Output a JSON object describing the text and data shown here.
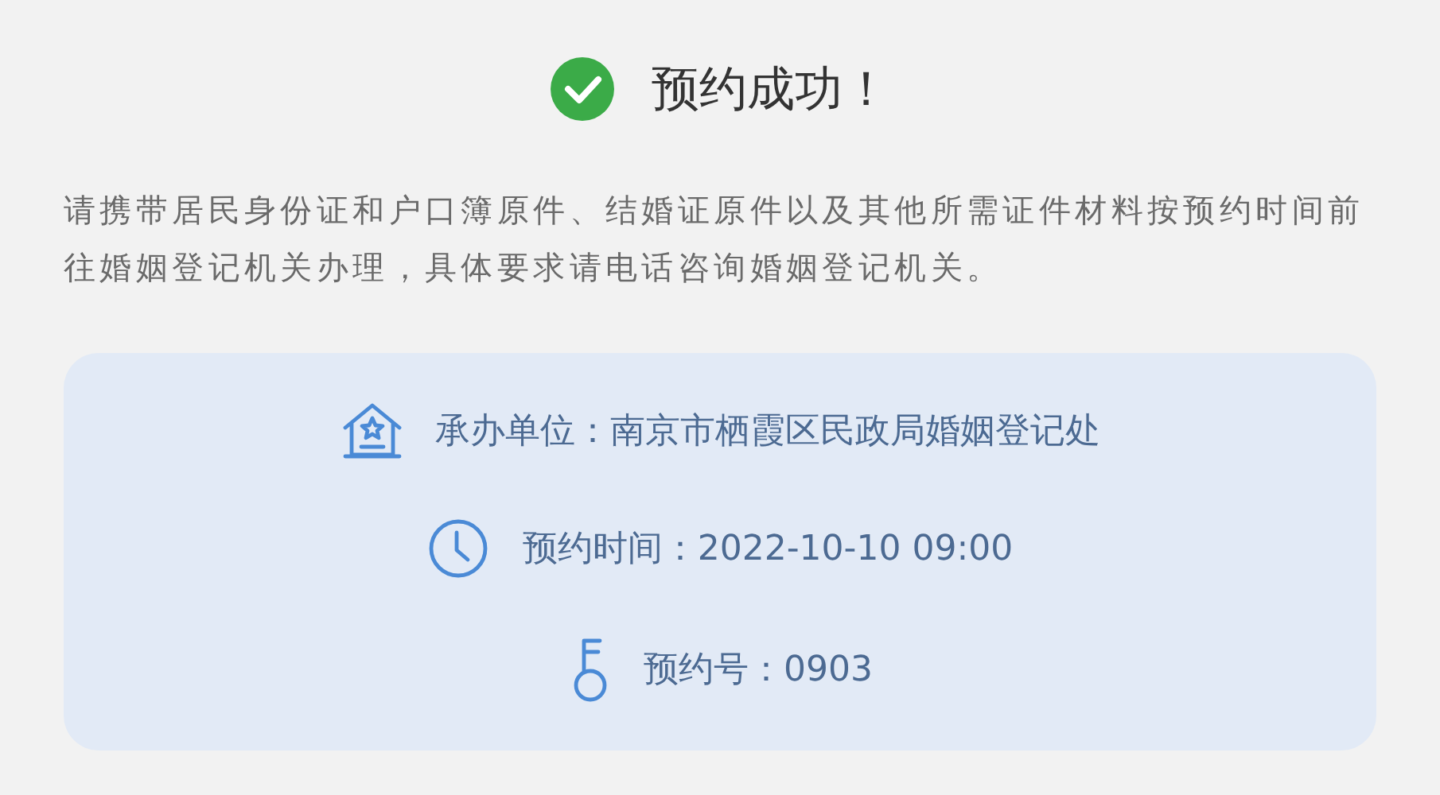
{
  "header": {
    "title": "预约成功！",
    "success": true
  },
  "notice": "请携带居民身份证和户口簿原件、结婚证原件以及其他所需证件材料按预约时间前往婚姻登记机关办理，具体要求请电话咨询婚姻登记机关。",
  "details": [
    {
      "kind": "office",
      "text": "承办单位：南京市栖霞区民政局婚姻登记处"
    },
    {
      "kind": "time",
      "text": "预约时间：2022-10-10 09:00"
    },
    {
      "kind": "number",
      "text": "预约号：0903"
    }
  ]
}
